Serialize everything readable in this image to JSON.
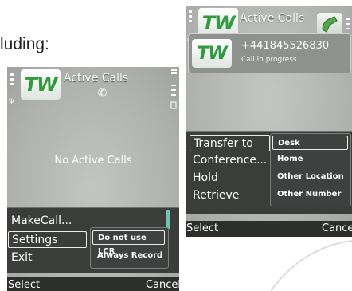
{
  "caption": "luding:",
  "left_screen": {
    "title": "Active Calls",
    "logo": "TW",
    "empty_message": "No Active Calls",
    "menu_items": [
      "MakeCall...",
      "Settings",
      "Exit"
    ],
    "submenu_items": [
      "Do not use LCR",
      "Always Record"
    ],
    "softkey_left": "Select",
    "softkey_right": "Cancel"
  },
  "right_screen": {
    "title": "Active Calls",
    "logo": "TW",
    "call": {
      "number": "+441845526830",
      "status": "Call in progress"
    },
    "menu_items": [
      "Transfer to",
      "Conference...",
      "Hold",
      "Retrieve"
    ],
    "submenu_items": [
      "Desk",
      "Home",
      "Other Location",
      "Other Number"
    ],
    "softkey_left": "Select",
    "softkey_right": "Cance"
  },
  "colors": {
    "logo_green": "#2e9b3c",
    "menu_bg": "#3b3d3b",
    "screen_bg": "#b7bab7"
  },
  "icons": [
    "signal-icon",
    "battery-icon",
    "handset-icon",
    "phone-answer-icon",
    "scroll-indicator"
  ]
}
